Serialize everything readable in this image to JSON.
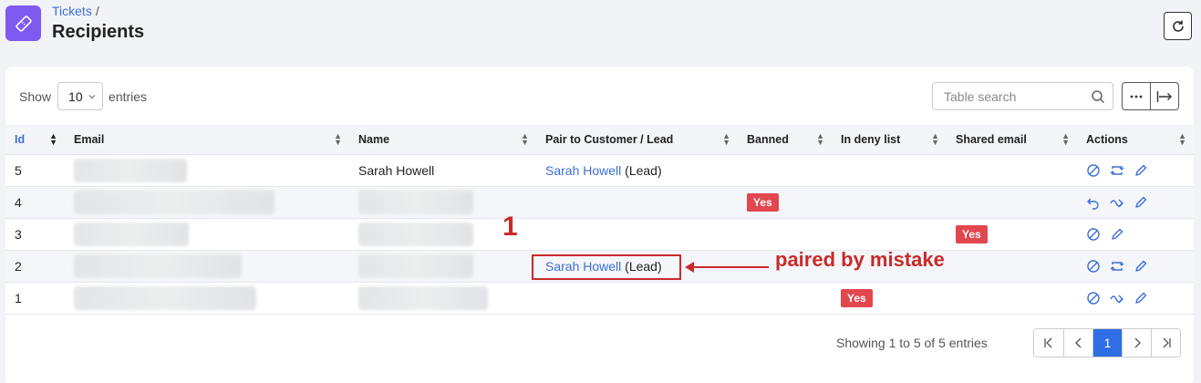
{
  "header": {
    "breadcrumb": "Tickets",
    "breadcrumb_sep": "/",
    "title": "Recipients",
    "app_icon": "ticket-icon",
    "refresh_icon": "refresh-icon"
  },
  "toolbar": {
    "show_label": "Show",
    "entries_value": "10",
    "entries_label": "entries",
    "search_placeholder": "Table search",
    "search_icon": "search-icon",
    "more_icon": "more-icon",
    "columns_icon": "columns-icon"
  },
  "table": {
    "columns": [
      "Id",
      "Email",
      "Name",
      "Pair to Customer / Lead",
      "Banned",
      "In deny list",
      "Shared email",
      "Actions"
    ],
    "rows": [
      {
        "id": "5",
        "name": "Sarah Howell",
        "pair_name": "Sarah Howell",
        "pair_type": "(Lead)",
        "banned": "",
        "deny": "",
        "shared": "",
        "actions": [
          "ban-icon",
          "pair-icon",
          "edit-icon"
        ]
      },
      {
        "id": "4",
        "name": "",
        "pair_name": "",
        "pair_type": "",
        "banned": "Yes",
        "deny": "",
        "shared": "",
        "actions": [
          "undo-icon",
          "forward-icon",
          "edit-icon"
        ]
      },
      {
        "id": "3",
        "name": "",
        "pair_name": "",
        "pair_type": "",
        "banned": "",
        "deny": "",
        "shared": "Yes",
        "actions": [
          "ban-icon",
          "edit-icon"
        ]
      },
      {
        "id": "2",
        "name": "",
        "pair_name": "Sarah Howell",
        "pair_type": "(Lead)",
        "banned": "",
        "deny": "",
        "shared": "",
        "actions": [
          "ban-icon",
          "pair-icon",
          "edit-icon"
        ]
      },
      {
        "id": "1",
        "name": "",
        "pair_name": "",
        "pair_type": "",
        "banned": "",
        "deny": "Yes",
        "shared": "",
        "actions": [
          "ban-icon",
          "forward-icon",
          "edit-icon"
        ]
      }
    ]
  },
  "footer": {
    "info": "Showing 1 to 5 of 5 entries",
    "current_page": "1"
  },
  "annotation": {
    "number": "1",
    "text": "paired by mistake",
    "color": "#c92a2a"
  },
  "colors": {
    "accent": "#7f5af0",
    "link": "#3b6fd6",
    "badge": "#e2474f",
    "pager_active": "#2f6ee5"
  }
}
